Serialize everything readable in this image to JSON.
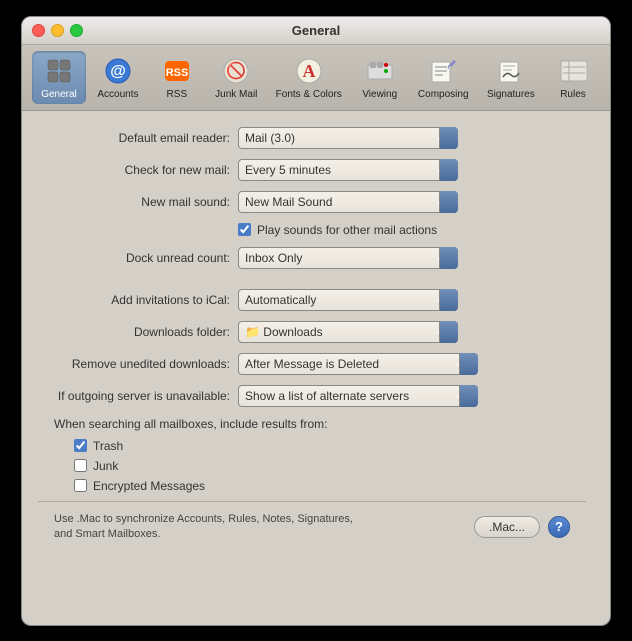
{
  "window": {
    "title": "General"
  },
  "toolbar": {
    "items": [
      {
        "id": "general",
        "label": "General",
        "icon": "⚙",
        "active": true
      },
      {
        "id": "accounts",
        "label": "Accounts",
        "icon": "@",
        "active": false
      },
      {
        "id": "rss",
        "label": "RSS",
        "icon": "RSS",
        "active": false
      },
      {
        "id": "junkmail",
        "label": "Junk Mail",
        "icon": "🚫",
        "active": false
      },
      {
        "id": "fonts",
        "label": "Fonts & Colors",
        "icon": "A",
        "active": false
      },
      {
        "id": "viewing",
        "label": "Viewing",
        "icon": "🚂",
        "active": false
      },
      {
        "id": "composing",
        "label": "Composing",
        "icon": "✏",
        "active": false
      },
      {
        "id": "signatures",
        "label": "Signatures",
        "icon": "✒",
        "active": false
      },
      {
        "id": "rules",
        "label": "Rules",
        "icon": "☰",
        "active": false
      }
    ]
  },
  "form": {
    "default_email_reader_label": "Default email reader:",
    "default_email_reader_value": "Mail (3.0)",
    "check_new_mail_label": "Check for new mail:",
    "check_new_mail_value": "Every 5 minutes",
    "new_mail_sound_label": "New mail sound:",
    "new_mail_sound_value": "New Mail Sound",
    "play_sounds_label": "Play sounds for other mail actions",
    "dock_unread_label": "Dock unread count:",
    "dock_unread_value": "Inbox Only",
    "add_invitations_label": "Add invitations to iCal:",
    "add_invitations_value": "Automatically",
    "downloads_folder_label": "Downloads folder:",
    "downloads_folder_value": "Downloads",
    "remove_unedited_label": "Remove unedited downloads:",
    "remove_unedited_value": "After Message is Deleted",
    "outgoing_server_label": "If outgoing server is unavailable:",
    "outgoing_server_value": "Show a list of alternate servers"
  },
  "searching": {
    "title": "When searching all mailboxes, include results from:",
    "checkboxes": [
      {
        "label": "Trash",
        "checked": true
      },
      {
        "label": "Junk",
        "checked": false
      },
      {
        "label": "Encrypted Messages",
        "checked": false
      }
    ]
  },
  "bottom": {
    "text": "Use .Mac to synchronize Accounts, Rules, Notes, Signatures, and Smart Mailboxes.",
    "mac_button_label": ".Mac...",
    "help_label": "?"
  }
}
